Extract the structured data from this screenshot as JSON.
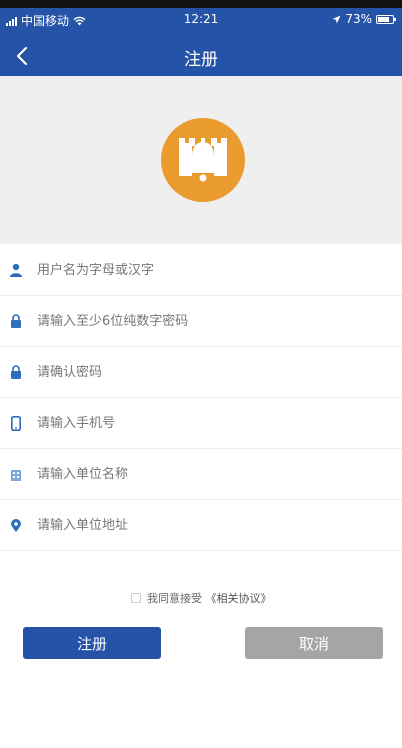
{
  "status_bar": {
    "carrier": "中国移动",
    "time": "12:21",
    "battery_percent": "73%"
  },
  "nav": {
    "title": "注册",
    "back_icon": "chevron-left-icon"
  },
  "logo": {
    "icon": "castle-bell-logo",
    "color": "#ea9b2d"
  },
  "form": {
    "fields": [
      {
        "icon": "user-icon",
        "placeholder": "用户名为字母或汉字",
        "value": ""
      },
      {
        "icon": "lock-icon",
        "placeholder": "请输入至少6位纯数字密码",
        "value": ""
      },
      {
        "icon": "lock-icon",
        "placeholder": "请确认密码",
        "value": ""
      },
      {
        "icon": "phone-icon",
        "placeholder": "请输入手机号",
        "value": ""
      },
      {
        "icon": "building-icon",
        "placeholder": "请输入单位名称",
        "value": ""
      },
      {
        "icon": "location-pin-icon",
        "placeholder": "请输入单位地址",
        "value": ""
      }
    ]
  },
  "agreement": {
    "text": "我同意接受",
    "link": "《相关协议》"
  },
  "buttons": {
    "register": "注册",
    "cancel": "取消"
  },
  "colors": {
    "primary": "#2453a8",
    "cancel": "#a5a5a5",
    "hero_bg": "#efefef"
  }
}
